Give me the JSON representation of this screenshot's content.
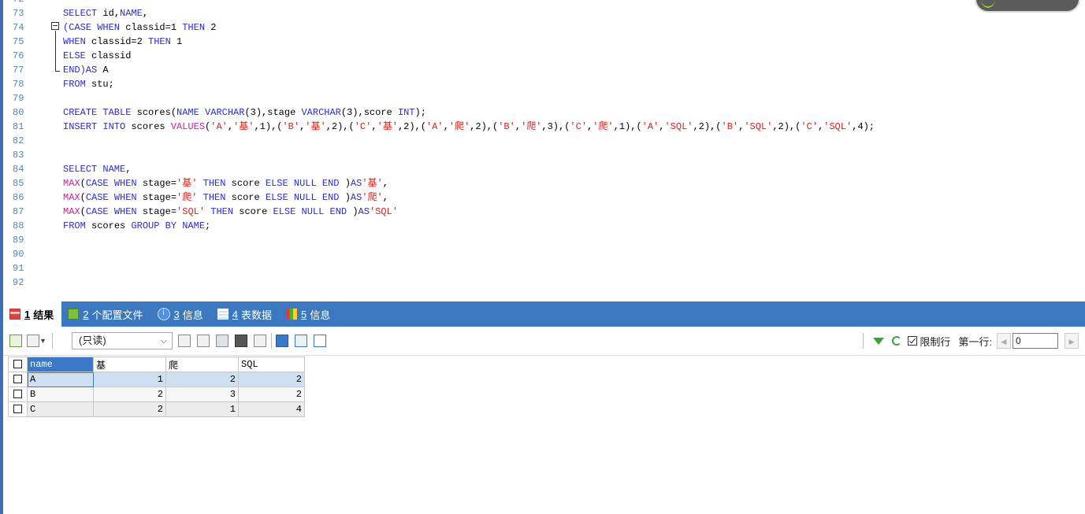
{
  "editor": {
    "top_partial_line": "72",
    "lines": [
      {
        "n": "73",
        "segs": [
          {
            "t": "SELECT",
            "c": "kw"
          },
          {
            "t": " id,",
            "c": ""
          },
          {
            "t": "NAME",
            "c": "kw"
          },
          {
            "t": ",",
            "c": ""
          }
        ]
      },
      {
        "n": "74",
        "segs": [
          {
            "t": "(CASE WHEN",
            "c": "kw"
          },
          {
            "t": " classid=1 ",
            "c": ""
          },
          {
            "t": "THEN",
            "c": "kw"
          },
          {
            "t": " 2",
            "c": ""
          }
        ]
      },
      {
        "n": "75",
        "segs": [
          {
            "t": "WHEN",
            "c": "kw"
          },
          {
            "t": " classid=2 ",
            "c": ""
          },
          {
            "t": "THEN",
            "c": "kw"
          },
          {
            "t": " 1",
            "c": ""
          }
        ]
      },
      {
        "n": "76",
        "segs": [
          {
            "t": "ELSE",
            "c": "kw"
          },
          {
            "t": " classid",
            "c": ""
          }
        ]
      },
      {
        "n": "77",
        "segs": [
          {
            "t": "END)AS",
            "c": "kw"
          },
          {
            "t": " A",
            "c": ""
          }
        ]
      },
      {
        "n": "78",
        "segs": [
          {
            "t": "FROM",
            "c": "kw"
          },
          {
            "t": " stu;",
            "c": ""
          }
        ]
      },
      {
        "n": "79",
        "segs": []
      },
      {
        "n": "80",
        "segs": [
          {
            "t": "CREATE TABLE",
            "c": "kw"
          },
          {
            "t": " scores(",
            "c": ""
          },
          {
            "t": "NAME VARCHAR",
            "c": "kw"
          },
          {
            "t": "(3),stage ",
            "c": ""
          },
          {
            "t": "VARCHAR",
            "c": "kw"
          },
          {
            "t": "(3),score ",
            "c": ""
          },
          {
            "t": "INT",
            "c": "kw"
          },
          {
            "t": ");",
            "c": ""
          }
        ]
      },
      {
        "n": "81",
        "segs": [
          {
            "t": "INSERT INTO",
            "c": "kw"
          },
          {
            "t": " scores ",
            "c": ""
          },
          {
            "t": "VALUES",
            "c": "fn"
          },
          {
            "t": "(",
            "c": ""
          },
          {
            "t": "'A'",
            "c": "str"
          },
          {
            "t": ",",
            "c": ""
          },
          {
            "t": "'基'",
            "c": "str"
          },
          {
            "t": ",1),(",
            "c": ""
          },
          {
            "t": "'B'",
            "c": "str"
          },
          {
            "t": ",",
            "c": ""
          },
          {
            "t": "'基'",
            "c": "str"
          },
          {
            "t": ",2),(",
            "c": ""
          },
          {
            "t": "'C'",
            "c": "str"
          },
          {
            "t": ",",
            "c": ""
          },
          {
            "t": "'基'",
            "c": "str"
          },
          {
            "t": ",2),(",
            "c": ""
          },
          {
            "t": "'A'",
            "c": "str"
          },
          {
            "t": ",",
            "c": ""
          },
          {
            "t": "'爬'",
            "c": "str"
          },
          {
            "t": ",2),(",
            "c": ""
          },
          {
            "t": "'B'",
            "c": "str"
          },
          {
            "t": ",",
            "c": ""
          },
          {
            "t": "'爬'",
            "c": "str"
          },
          {
            "t": ",3),(",
            "c": ""
          },
          {
            "t": "'C'",
            "c": "str"
          },
          {
            "t": ",",
            "c": ""
          },
          {
            "t": "'爬'",
            "c": "str"
          },
          {
            "t": ",1),(",
            "c": ""
          },
          {
            "t": "'A'",
            "c": "str"
          },
          {
            "t": ",",
            "c": ""
          },
          {
            "t": "'SQL'",
            "c": "str"
          },
          {
            "t": ",2),(",
            "c": ""
          },
          {
            "t": "'B'",
            "c": "str"
          },
          {
            "t": ",",
            "c": ""
          },
          {
            "t": "'SQL'",
            "c": "str"
          },
          {
            "t": ",2),(",
            "c": ""
          },
          {
            "t": "'C'",
            "c": "str"
          },
          {
            "t": ",",
            "c": ""
          },
          {
            "t": "'SQL'",
            "c": "str"
          },
          {
            "t": ",4);",
            "c": ""
          }
        ]
      },
      {
        "n": "82",
        "segs": []
      },
      {
        "n": "83",
        "segs": []
      },
      {
        "n": "84",
        "segs": [
          {
            "t": "SELECT NAME",
            "c": "kw"
          },
          {
            "t": ",",
            "c": ""
          }
        ]
      },
      {
        "n": "85",
        "segs": [
          {
            "t": "MAX",
            "c": "fn"
          },
          {
            "t": "(",
            "c": ""
          },
          {
            "t": "CASE WHEN",
            "c": "kw"
          },
          {
            "t": " stage=",
            "c": ""
          },
          {
            "t": "'基'",
            "c": "str"
          },
          {
            "t": " ",
            "c": ""
          },
          {
            "t": "THEN",
            "c": "kw"
          },
          {
            "t": " score ",
            "c": ""
          },
          {
            "t": "ELSE NULL END",
            "c": "kw"
          },
          {
            "t": " )",
            "c": ""
          },
          {
            "t": "AS",
            "c": "kw"
          },
          {
            "t": "'基'",
            "c": "str"
          },
          {
            "t": ",",
            "c": ""
          }
        ]
      },
      {
        "n": "86",
        "segs": [
          {
            "t": "MAX",
            "c": "fn"
          },
          {
            "t": "(",
            "c": ""
          },
          {
            "t": "CASE WHEN",
            "c": "kw"
          },
          {
            "t": " stage=",
            "c": ""
          },
          {
            "t": "'爬'",
            "c": "str"
          },
          {
            "t": " ",
            "c": ""
          },
          {
            "t": "THEN",
            "c": "kw"
          },
          {
            "t": " score ",
            "c": ""
          },
          {
            "t": "ELSE NULL END",
            "c": "kw"
          },
          {
            "t": " )",
            "c": ""
          },
          {
            "t": "AS",
            "c": "kw"
          },
          {
            "t": "'爬'",
            "c": "str"
          },
          {
            "t": ",",
            "c": ""
          }
        ]
      },
      {
        "n": "87",
        "segs": [
          {
            "t": "MAX",
            "c": "fn"
          },
          {
            "t": "(",
            "c": ""
          },
          {
            "t": "CASE WHEN",
            "c": "kw"
          },
          {
            "t": " stage=",
            "c": ""
          },
          {
            "t": "'SQL'",
            "c": "str"
          },
          {
            "t": " ",
            "c": ""
          },
          {
            "t": "THEN",
            "c": "kw"
          },
          {
            "t": " score ",
            "c": ""
          },
          {
            "t": "ELSE NULL END",
            "c": "kw"
          },
          {
            "t": " )",
            "c": ""
          },
          {
            "t": "AS",
            "c": "kw"
          },
          {
            "t": "'SQL'",
            "c": "str"
          }
        ]
      },
      {
        "n": "88",
        "segs": [
          {
            "t": "FROM",
            "c": "kw"
          },
          {
            "t": " scores ",
            "c": ""
          },
          {
            "t": "GROUP BY NAME",
            "c": "kw"
          },
          {
            "t": ";",
            "c": ""
          }
        ]
      },
      {
        "n": "89",
        "segs": []
      },
      {
        "n": "90",
        "segs": []
      },
      {
        "n": "91",
        "segs": []
      },
      {
        "n": "92",
        "segs": []
      }
    ]
  },
  "tabs": [
    {
      "num": "1",
      "label": "结果",
      "icon": "result-grid-icon",
      "active": true
    },
    {
      "num": "2",
      "label": "个配置文件",
      "icon": "profile-icon",
      "active": false
    },
    {
      "num": "3",
      "label": "信息",
      "icon": "info-icon",
      "active": false
    },
    {
      "num": "4",
      "label": "表数据",
      "icon": "table-data-icon",
      "active": false
    },
    {
      "num": "5",
      "label": "信息",
      "icon": "info-stats-icon",
      "active": false
    }
  ],
  "toolbar": {
    "readonly_value": "(只读)",
    "limit_rows_label": "限制行",
    "first_row_label": "第一行:",
    "first_row_value": "0"
  },
  "grid": {
    "columns": [
      "name",
      "基",
      "爬",
      "SQL"
    ],
    "rows": [
      [
        "A",
        "1",
        "2",
        "2"
      ],
      [
        "B",
        "2",
        "3",
        "2"
      ],
      [
        "C",
        "2",
        "1",
        "4"
      ]
    ]
  },
  "colors": {
    "keyword": "#2b2bd9",
    "function": "#d21e9b",
    "string": "#e0201a",
    "line_number": "#4a8ab8",
    "tabbar": "#3b78c0"
  }
}
